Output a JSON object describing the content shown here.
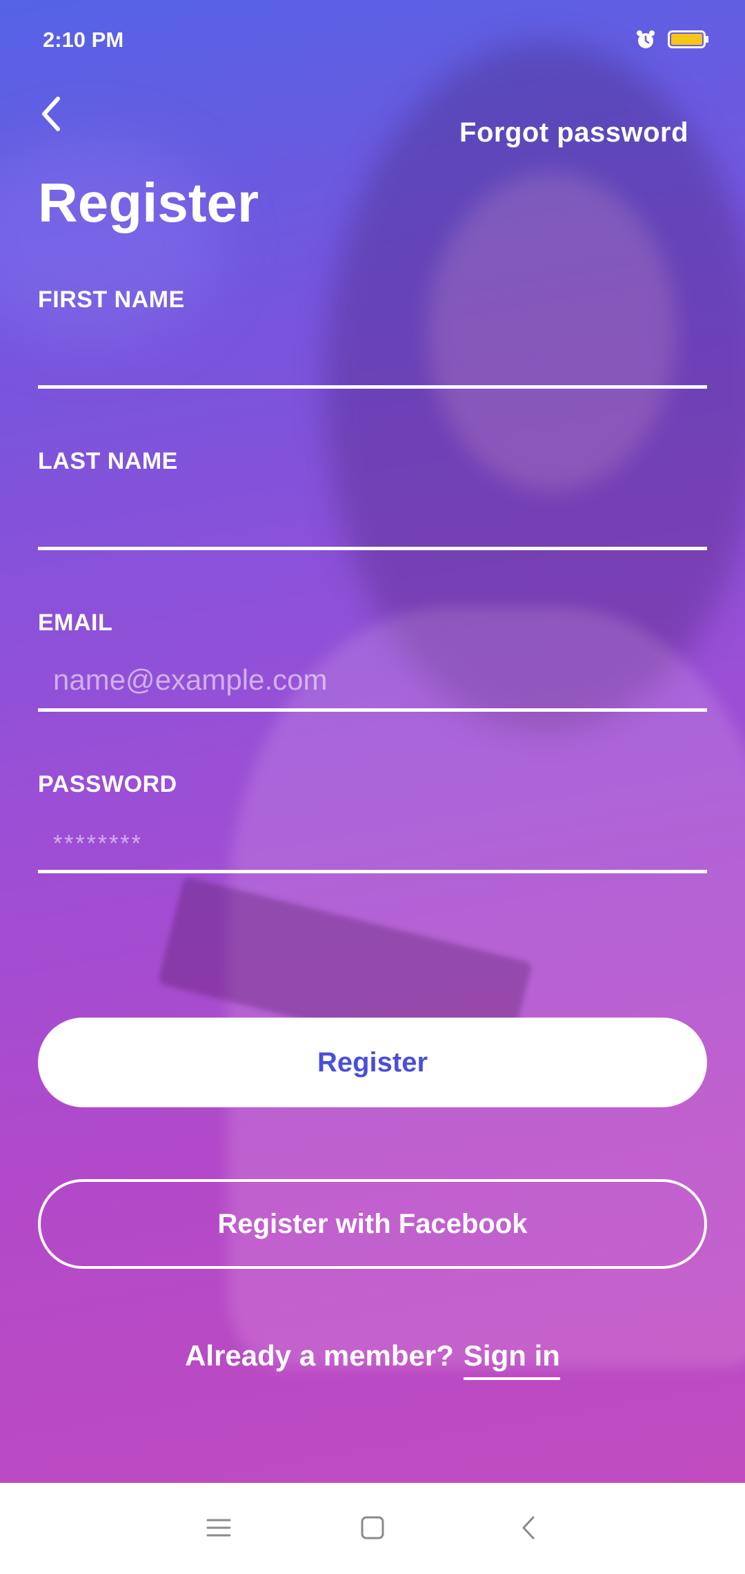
{
  "status_bar": {
    "time": "2:10 PM",
    "alarm_icon": "alarm-clock-icon",
    "battery_icon": "battery-icon",
    "battery_color": "#f5c518"
  },
  "header": {
    "back_icon": "chevron-left-icon",
    "forgot_password": "Forgot password",
    "title": "Register"
  },
  "form": {
    "first_name": {
      "label": "FIRST NAME",
      "value": "",
      "placeholder": ""
    },
    "last_name": {
      "label": "LAST NAME",
      "value": "",
      "placeholder": ""
    },
    "email": {
      "label": "EMAIL",
      "value": "",
      "placeholder": "name@example.com"
    },
    "password": {
      "label": "PASSWORD",
      "value": "",
      "placeholder": "********"
    }
  },
  "actions": {
    "register": "Register",
    "register_facebook": "Register with Facebook"
  },
  "footer": {
    "prompt": "Already a member?",
    "sign_in": "Sign in"
  },
  "colors": {
    "gradient_top": "#5563e6",
    "gradient_bottom": "#c04cc0",
    "primary_button_text": "#4a4fd9"
  },
  "nav_bar": {
    "menu_icon": "menu-icon",
    "home_icon": "home-square-icon",
    "back_icon": "back-chevron-icon"
  }
}
